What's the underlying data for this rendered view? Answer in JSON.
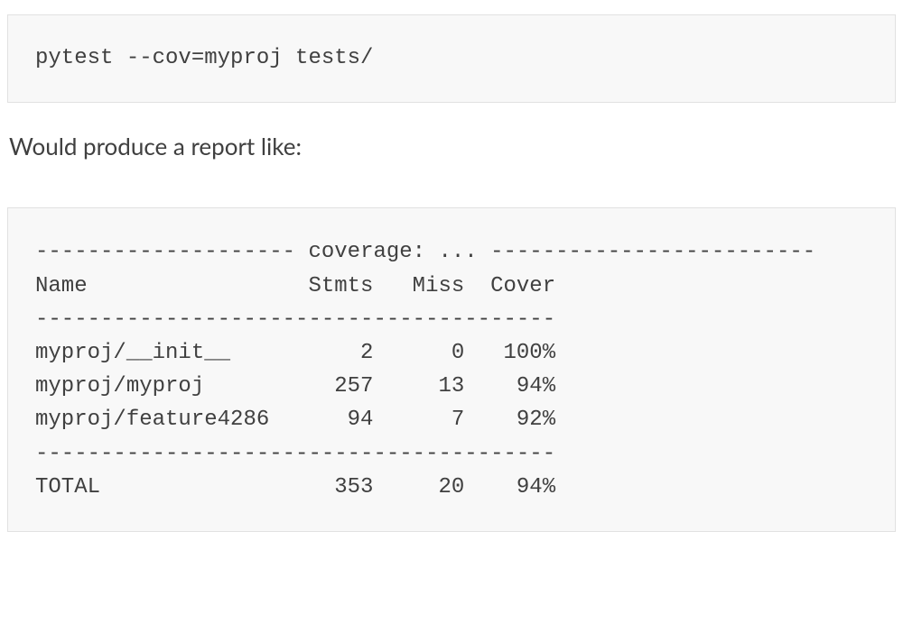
{
  "command": "pytest --cov=myproj tests/",
  "description": "Would produce a report like:",
  "report": {
    "header_rule_left": "-------------------- ",
    "header_title": "coverage: ... ",
    "header_rule_right": "-------------------------",
    "columns_line": "Name                 Stmts   Miss  Cover",
    "rule": "----------------------------------------",
    "rows": [
      {
        "name": "myproj/__init__",
        "stmts": 2,
        "miss": 0,
        "cover": "100%"
      },
      {
        "name": "myproj/myproj",
        "stmts": 257,
        "miss": 13,
        "cover": "94%"
      },
      {
        "name": "myproj/feature4286",
        "stmts": 94,
        "miss": 7,
        "cover": "92%"
      }
    ],
    "total": {
      "name": "TOTAL",
      "stmts": 353,
      "miss": 20,
      "cover": "94%"
    }
  },
  "chart_data": {
    "type": "table",
    "title": "coverage",
    "columns": [
      "Name",
      "Stmts",
      "Miss",
      "Cover"
    ],
    "rows": [
      [
        "myproj/__init__",
        2,
        0,
        "100%"
      ],
      [
        "myproj/myproj",
        257,
        13,
        "94%"
      ],
      [
        "myproj/feature4286",
        94,
        7,
        "92%"
      ]
    ],
    "total": [
      "TOTAL",
      353,
      20,
      "94%"
    ]
  }
}
